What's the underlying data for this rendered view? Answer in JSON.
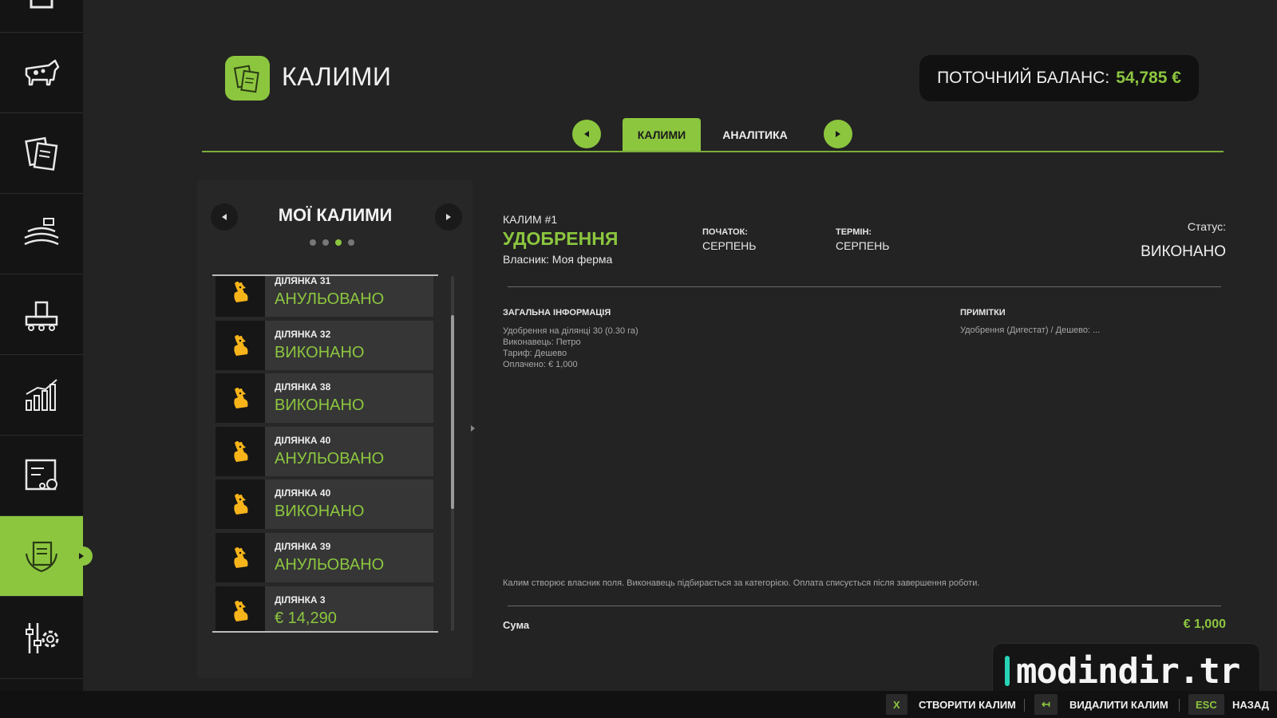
{
  "header": {
    "title": "КАЛИМИ",
    "balance_label": "ПОТОЧНИЙ БАЛАНС:",
    "balance_value": "54,785 €"
  },
  "tabs": [
    {
      "label": "КАЛИМИ",
      "active": true
    },
    {
      "label": "АНАЛІТИКА",
      "active": false
    }
  ],
  "sidebar": {
    "items": [
      {
        "icon": "calendar-icon"
      },
      {
        "icon": "cow-icon"
      },
      {
        "icon": "documents-icon"
      },
      {
        "icon": "field-crops-icon"
      },
      {
        "icon": "production-icon"
      },
      {
        "icon": "statistics-icon"
      },
      {
        "icon": "vehicle-shop-icon"
      },
      {
        "icon": "contracts-icon",
        "active": true
      },
      {
        "icon": "settings-icon"
      }
    ]
  },
  "list_panel": {
    "title": "МОЇ КАЛИМИ",
    "page_count": 4,
    "current_page": 3,
    "items": [
      {
        "field": "ДІЛЯНКА 31",
        "status": "АНУЛЬОВАНО"
      },
      {
        "field": "ДІЛЯНКА 32",
        "status": "ВИКОНАНО"
      },
      {
        "field": "ДІЛЯНКА 38",
        "status": "ВИКОНАНО"
      },
      {
        "field": "ДІЛЯНКА 40",
        "status": "АНУЛЬОВАНО"
      },
      {
        "field": "ДІЛЯНКА 40",
        "status": "ВИКОНАНО"
      },
      {
        "field": "ДІЛЯНКА 39",
        "status": "АНУЛЬОВАНО"
      },
      {
        "field": "ДІЛЯНКА 3",
        "status": "€ 14,290"
      }
    ]
  },
  "detail": {
    "number": "КАЛИМ #1",
    "type": "УДОБРЕННЯ",
    "owner": "Власник: Моя ферма",
    "start_label": "ПОЧАТОК:",
    "start_value": "СЕРПЕНЬ",
    "term_label": "ТЕРМІН:",
    "term_value": "СЕРПЕНЬ",
    "status_label": "Статус:",
    "status_value": "ВИКОНАНО",
    "general_title": "ЗАГАЛЬНА ІНФОРМАЦІЯ",
    "general_lines": [
      "Удобрення на ділянці 30 (0.30 га)",
      "Виконавець: Петро",
      "Тариф: Дешево",
      "Оплачено: € 1,000"
    ],
    "notes_title": "ПРИМІТКИ",
    "notes_text": "Удобрення (Дигестат) / Дешево: ...",
    "footnote": "Калим створює власник поля. Виконавець підбирається за категорією. Оплата списується після завершення роботи.",
    "sum_label": "Сума",
    "sum_value": "€ 1,000"
  },
  "watermark": "modindir.tr",
  "bottom_actions": [
    {
      "key": "X",
      "label": "СТВОРИТИ КАЛИМ"
    },
    {
      "key": "↤",
      "label": "ВИДАЛИТИ КАЛИМ"
    },
    {
      "key": "ESC",
      "label": "НАЗАД"
    }
  ],
  "colors": {
    "accent": "#8cc63f",
    "background": "#232323",
    "sidebar": "#141414",
    "watermark_bar": "#27d3b5"
  }
}
